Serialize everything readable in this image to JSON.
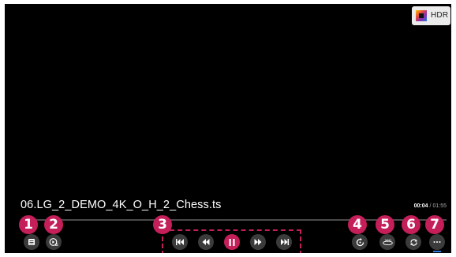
{
  "hdr_badge": {
    "label": "HDR"
  },
  "file": {
    "name": "06.LG_2_DEMO_4K_O_H_2_Chess.ts"
  },
  "playback": {
    "current_time": "00:04",
    "separator": "/",
    "total_time": "01:55",
    "progress_fraction": 0.035
  },
  "markers": [
    "1",
    "2",
    "3",
    "4",
    "5",
    "6",
    "7"
  ],
  "colors": {
    "accent": "#c41f58",
    "control_bg": "#3b3b3b",
    "screen_bg": "#000000",
    "settings_underline": "#2f7bd8"
  },
  "controls": {
    "playlist": {
      "icon": "playlist-icon"
    },
    "play_mode": {
      "icon": "play-mode-icon"
    },
    "previous": {
      "icon": "skip-previous-icon"
    },
    "rewind": {
      "icon": "rewind-icon"
    },
    "pause": {
      "icon": "pause-icon"
    },
    "fast_forward": {
      "icon": "fast-forward-icon"
    },
    "next": {
      "icon": "skip-next-icon"
    },
    "resume": {
      "icon": "restart-icon"
    },
    "view_360": {
      "icon": "360-view-icon"
    },
    "repeat": {
      "icon": "repeat-icon"
    },
    "more": {
      "icon": "more-icon"
    }
  }
}
